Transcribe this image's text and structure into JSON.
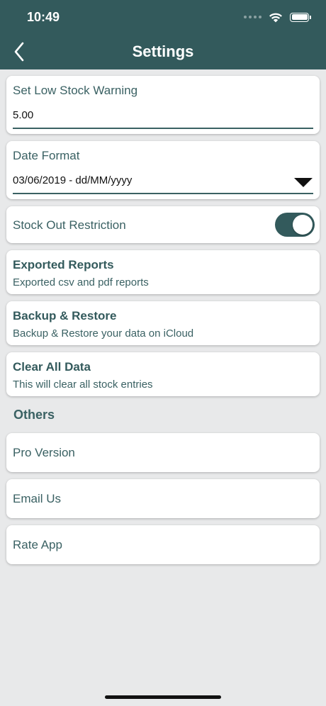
{
  "status_bar": {
    "time": "10:49"
  },
  "header": {
    "title": "Settings"
  },
  "low_stock": {
    "label": "Set Low Stock Warning",
    "value": "5.00"
  },
  "date_format": {
    "label": "Date Format",
    "value": "03/06/2019 - dd/MM/yyyy"
  },
  "stock_out": {
    "label": "Stock Out Restriction",
    "enabled": true
  },
  "exported_reports": {
    "title": "Exported Reports",
    "subtitle": "Exported csv and pdf reports"
  },
  "backup_restore": {
    "title": "Backup & Restore",
    "subtitle": "Backup & Restore your data on iCloud"
  },
  "clear_data": {
    "title": "Clear All Data",
    "subtitle": "This will clear all stock entries"
  },
  "others": {
    "header": "Others",
    "items": [
      "Pro Version",
      "Email Us",
      "Rate App"
    ]
  },
  "colors": {
    "primary": "#335a5c",
    "background": "#e8e9ea",
    "card": "#ffffff"
  },
  "icons": {
    "back": "chevron-left-icon",
    "wifi": "wifi-icon",
    "battery": "battery-icon",
    "dropdown": "triangle-down-icon"
  }
}
